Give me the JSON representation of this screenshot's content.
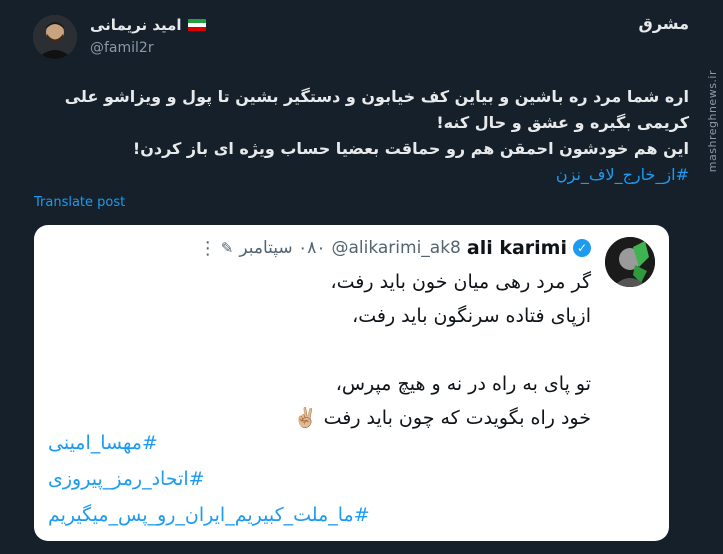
{
  "author": {
    "name": "امید نریمانی",
    "handle": "@famil2r"
  },
  "logo_text": "مشرق",
  "watermark": "mashreghnews.ir",
  "tweet": {
    "lines": [
      "اره شما مرد ره باشین و بیاین کف خیابون و دستگیر بشین تا پول و ویزاشو علی",
      "کریمی بگیره و عشق و حال کنه!",
      "این هم خودشون احمقن هم رو حماقت بعضیا حساب ویژه ای باز کردن!"
    ],
    "hashtag": "#از_خارج_لاف_نزن"
  },
  "translate_label": "Translate post",
  "quoted": {
    "name": "ali karimi",
    "handle": "@alikarimi_ak8",
    "date": "۰۸۰ سپتامبر",
    "poem": [
      "گر مرد رهی میان خون باید رفت،",
      "ازپای فتاده سرنگون باید رفت،",
      "",
      "تو پای به راه در نه و هیچ مپرس،",
      "خود راه  بگویدت که چون باید رفت ✌🏼"
    ],
    "hashtags": [
      "#مهسا_امینی",
      "#اتحاد_رمز_پیروزی",
      "#ما_ملت_کبیریم_ایران_رو_پس_میگیریم"
    ]
  },
  "colors": {
    "background": "#15202b",
    "link": "#1d9bf0",
    "card": "#ffffff"
  }
}
